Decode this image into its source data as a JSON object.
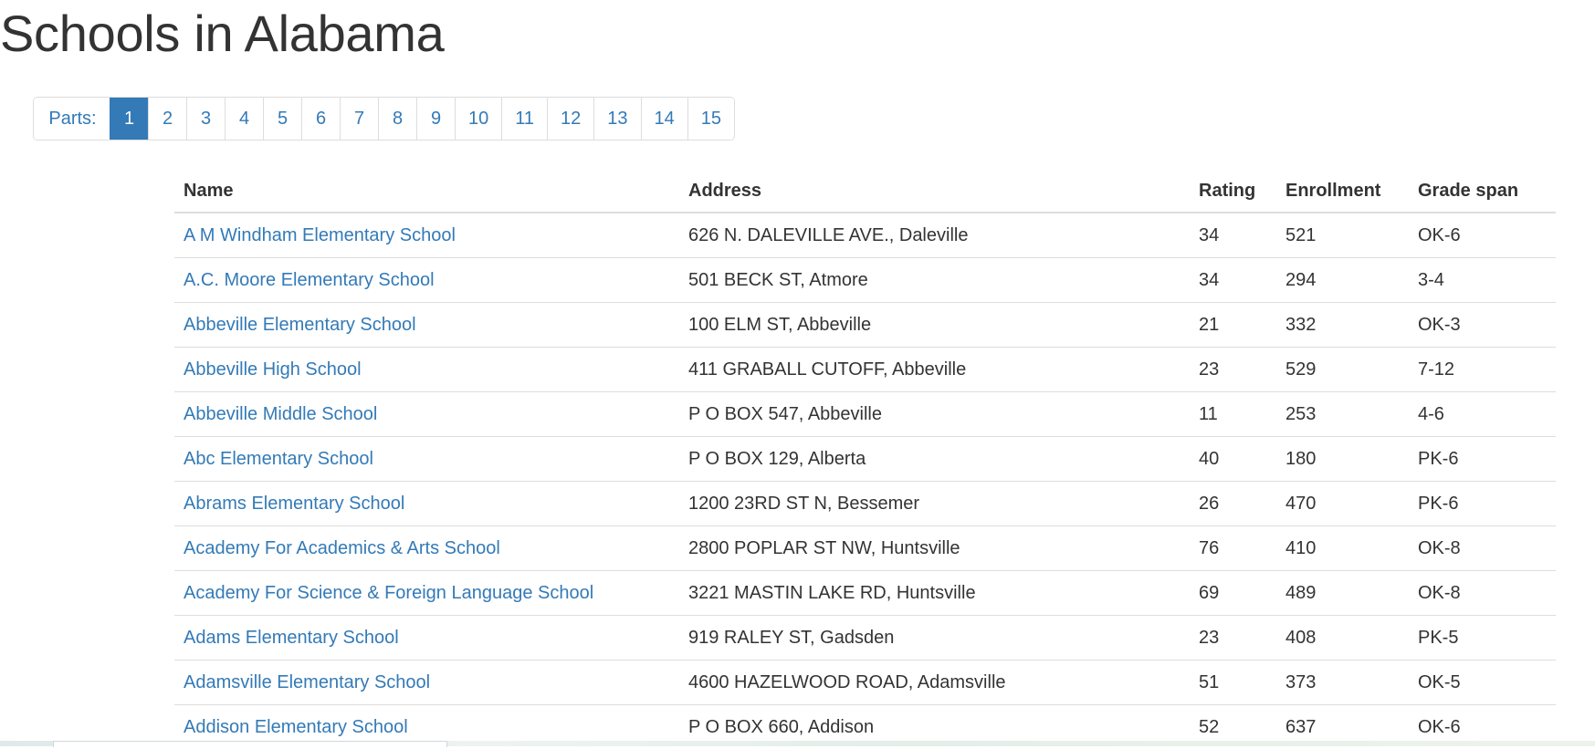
{
  "page": {
    "title": "Schools in Alabama"
  },
  "pagination": {
    "label": "Parts:",
    "active": "1",
    "pages": [
      "1",
      "2",
      "3",
      "4",
      "5",
      "6",
      "7",
      "8",
      "9",
      "10",
      "11",
      "12",
      "13",
      "14",
      "15"
    ]
  },
  "table": {
    "headers": {
      "name": "Name",
      "address": "Address",
      "rating": "Rating",
      "enrollment": "Enrollment",
      "grade_span": "Grade span"
    },
    "rows": [
      {
        "name": "A M Windham Elementary School",
        "address": "626 N. DALEVILLE AVE., Daleville",
        "rating": "34",
        "enrollment": "521",
        "grade_span": "OK-6"
      },
      {
        "name": "A.C. Moore Elementary School",
        "address": "501 BECK ST, Atmore",
        "rating": "34",
        "enrollment": "294",
        "grade_span": "3-4"
      },
      {
        "name": "Abbeville Elementary School",
        "address": "100 ELM ST, Abbeville",
        "rating": "21",
        "enrollment": "332",
        "grade_span": "OK-3"
      },
      {
        "name": "Abbeville High School",
        "address": "411 GRABALL CUTOFF, Abbeville",
        "rating": "23",
        "enrollment": "529",
        "grade_span": "7-12"
      },
      {
        "name": "Abbeville Middle School",
        "address": "P O BOX 547, Abbeville",
        "rating": "11",
        "enrollment": "253",
        "grade_span": "4-6"
      },
      {
        "name": "Abc Elementary School",
        "address": "P O BOX 129, Alberta",
        "rating": "40",
        "enrollment": "180",
        "grade_span": "PK-6"
      },
      {
        "name": "Abrams Elementary School",
        "address": "1200 23RD ST N, Bessemer",
        "rating": "26",
        "enrollment": "470",
        "grade_span": "PK-6"
      },
      {
        "name": "Academy For Academics & Arts School",
        "address": "2800 POPLAR ST NW, Huntsville",
        "rating": "76",
        "enrollment": "410",
        "grade_span": "OK-8"
      },
      {
        "name": "Academy For Science & Foreign Language School",
        "address": "3221 MASTIN LAKE RD, Huntsville",
        "rating": "69",
        "enrollment": "489",
        "grade_span": "OK-8"
      },
      {
        "name": "Adams Elementary School",
        "address": "919 RALEY ST, Gadsden",
        "rating": "23",
        "enrollment": "408",
        "grade_span": "PK-5"
      },
      {
        "name": "Adamsville Elementary School",
        "address": "4600 HAZELWOOD ROAD, Adamsville",
        "rating": "51",
        "enrollment": "373",
        "grade_span": "OK-5"
      },
      {
        "name": "Addison Elementary School",
        "address": "P O BOX 660, Addison",
        "rating": "52",
        "enrollment": "637",
        "grade_span": "OK-6"
      }
    ]
  }
}
